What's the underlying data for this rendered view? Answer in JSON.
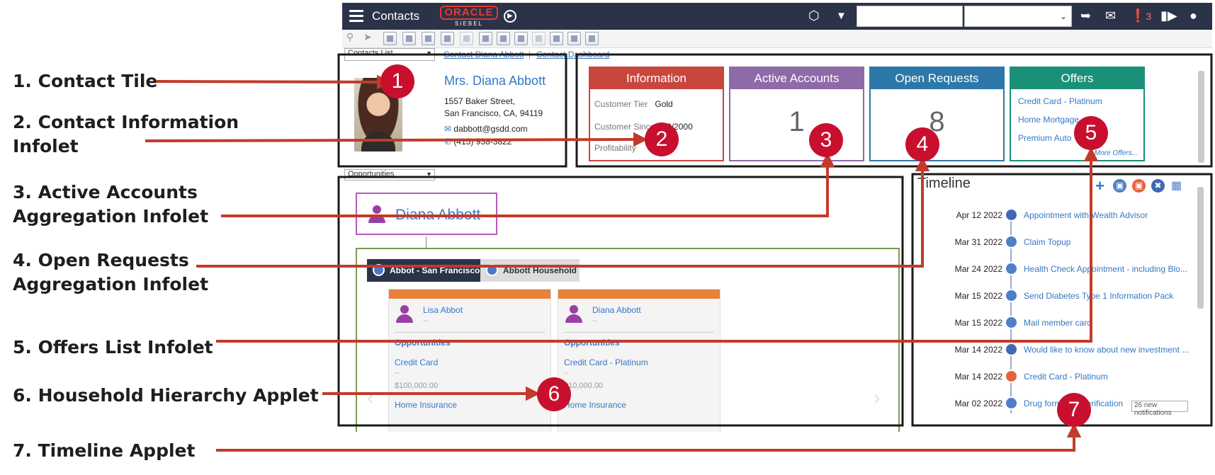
{
  "legend": [
    {
      "n": "1",
      "lines": [
        "1. Contact Tile"
      ]
    },
    {
      "n": "2",
      "lines": [
        "2. Contact Information",
        "Infolet"
      ]
    },
    {
      "n": "3",
      "lines": [
        "3. Active Accounts",
        "Aggregation Infolet"
      ]
    },
    {
      "n": "4",
      "lines": [
        "4. Open Requests",
        "Aggregation Infolet"
      ]
    },
    {
      "n": "5",
      "lines": [
        "5. Offers List Infolet"
      ]
    },
    {
      "n": "6",
      "lines": [
        "6. Household Hierarchy Applet"
      ]
    },
    {
      "n": "7",
      "lines": [
        "7. Timeline Applet"
      ]
    }
  ],
  "callouts": [
    "1",
    "2",
    "3",
    "4",
    "5",
    "6",
    "7"
  ],
  "topbar": {
    "app_title": "Contacts",
    "logo_oracle": "ORACLE",
    "logo_siebel": "SIEBEL",
    "notification_count": "3",
    "icons": [
      "menu-icon",
      "forward-circle-icon",
      "cube-icon",
      "filter-icon",
      "share-icon",
      "chat-icon",
      "notification-icon",
      "video-icon",
      "user-icon"
    ]
  },
  "nav": {
    "dropdown_label": "Contacts List",
    "crumb_contact": "Contact Diana Abbott",
    "crumb_sep": "|",
    "crumb_dashboard": "Contact Dashboard",
    "section_dropdown": "Opportunities"
  },
  "contact": {
    "name": "Mrs. Diana Abbott",
    "street": "1557 Baker Street,",
    "city": "San Francisco, CA, 94119",
    "email": "dabbott@gsdd.com",
    "phone": "(415) 938-3822"
  },
  "infolets": {
    "information": {
      "title": "Information",
      "tier_label": "Customer Tier",
      "tier_value": "Gold",
      "since_label": "Customer Since",
      "since_value": "02/2000",
      "profit_label": "Profitability",
      "color": "#c9463d"
    },
    "accounts": {
      "title": "Active Accounts",
      "value": "1",
      "color": "#8e6aa8"
    },
    "requests": {
      "title": "Open Requests",
      "value": "8",
      "color": "#2d78a8"
    },
    "offers": {
      "title": "Offers",
      "items": [
        "Credit Card - Platinum",
        "Home Mortgage",
        "Premium Auto"
      ],
      "more": "More Offers...",
      "color": "#1a9079"
    }
  },
  "household": {
    "root": "Diana Abbott",
    "tabs": [
      "Abbot - San Francisco",
      "Abbott Household"
    ],
    "members": [
      {
        "name": "Lisa Abbot",
        "dash": "--",
        "opp_heading": "Opportunities",
        "opp1": "Credit Card",
        "opp1_dash": "--",
        "opp1_amount": "$100,000.00",
        "opp2": "Home Insurance"
      },
      {
        "name": "Diana Abbott",
        "dash": "--",
        "opp_heading": "Opportunities",
        "opp1": "Credit Card - Platinum",
        "opp1_dash": "--",
        "opp1_amount": "$10,000.00",
        "opp2": "Home Insurance"
      }
    ]
  },
  "timeline": {
    "title": "Timeline",
    "events": [
      {
        "date": "Apr 12 2022",
        "text": "Appointment with Wealth Advisor",
        "icon": "tools-icon",
        "color": "#3f69b5"
      },
      {
        "date": "Mar 31 2022",
        "text": "Claim Topup",
        "icon": "document-icon",
        "color": "#4e7fc7"
      },
      {
        "date": "Mar 24 2022",
        "text": "Health Check Appointment - including Blo...",
        "icon": "document-icon",
        "color": "#4e7fc7"
      },
      {
        "date": "Mar 15 2022",
        "text": "Send Diabetes Type 1 Information Pack",
        "icon": "document-icon",
        "color": "#4e7fc7"
      },
      {
        "date": "Mar 15 2022",
        "text": "Mail member card",
        "icon": "document-icon",
        "color": "#4e7fc7"
      },
      {
        "date": "Mar 14 2022",
        "text": "Would like to know about new investment ...",
        "icon": "tools-icon",
        "color": "#3f69b5"
      },
      {
        "date": "Mar 14 2022",
        "text": "Credit Card - Platinum",
        "icon": "offer-icon",
        "color": "#e8623a"
      },
      {
        "date": "Mar 02 2022",
        "text": "Drug formulary verification",
        "icon": "document-icon",
        "color": "#4e7fc7"
      }
    ],
    "notifications": "26 new notifications",
    "add_symbol": "+"
  }
}
